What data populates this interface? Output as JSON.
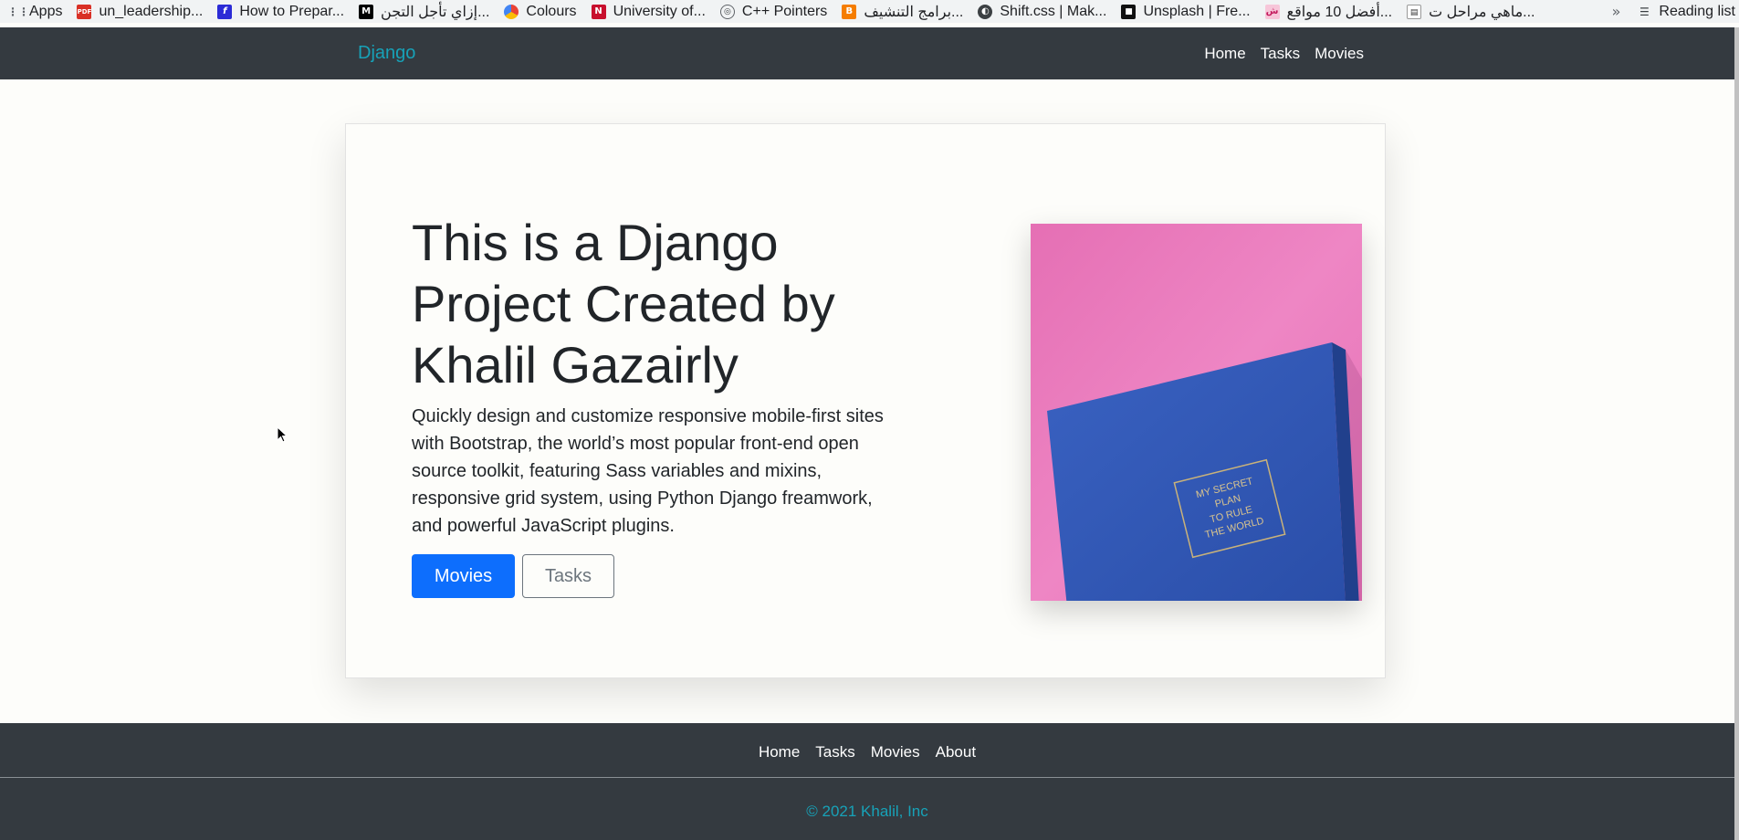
{
  "bookmarks": {
    "items": [
      {
        "label": "Apps",
        "icon": "apps-grid-icon"
      },
      {
        "label": "un_leadership...",
        "icon": "pdf-icon"
      },
      {
        "label": "How to Prepar...",
        "icon": "f-logo-icon"
      },
      {
        "label": "إزاي تأجل التجن...",
        "icon": "medium-icon"
      },
      {
        "label": "Colours",
        "icon": "colours-icon"
      },
      {
        "label": "University of...",
        "icon": "university-icon"
      },
      {
        "label": "C++ Pointers",
        "icon": "cpp-icon"
      },
      {
        "label": "برامج التنشيف...",
        "icon": "blogger-icon"
      },
      {
        "label": "Shift.css | Mak...",
        "icon": "globe-icon"
      },
      {
        "label": "Unsplash | Fre...",
        "icon": "unsplash-icon"
      },
      {
        "label": "أفضل 10 مواقع...",
        "icon": "site-icon"
      },
      {
        "label": "ماهي مراحل ت...",
        "icon": "page-icon"
      }
    ],
    "more": "»",
    "reading_list": "Reading list"
  },
  "navbar": {
    "brand": "Django",
    "links": [
      "Home",
      "Tasks",
      "Movies"
    ]
  },
  "hero": {
    "title": "This is a Django Project Created by Khalil Gazairly",
    "text": "Quickly design and customize responsive mobile-first sites with Bootstrap, the world’s most popular front-end open source toolkit, featuring Sass variables and mixins, responsive grid system, using Python Django freamwork, and powerful JavaScript plugins.",
    "primary_button": "Movies",
    "secondary_button": "Tasks",
    "image_text": [
      "MY SECRET",
      "PLAN",
      "TO RULE",
      "THE WORLD"
    ]
  },
  "footer": {
    "links": [
      "Home",
      "Tasks",
      "Movies",
      "About"
    ],
    "copyright": "© 2021 Khalil, Inc"
  },
  "colors": {
    "navbar_bg": "#343a40",
    "brand": "#17a2b8",
    "primary": "#0d6efd",
    "image_bg": "#ea7bbd",
    "book": "#2f55b0"
  }
}
